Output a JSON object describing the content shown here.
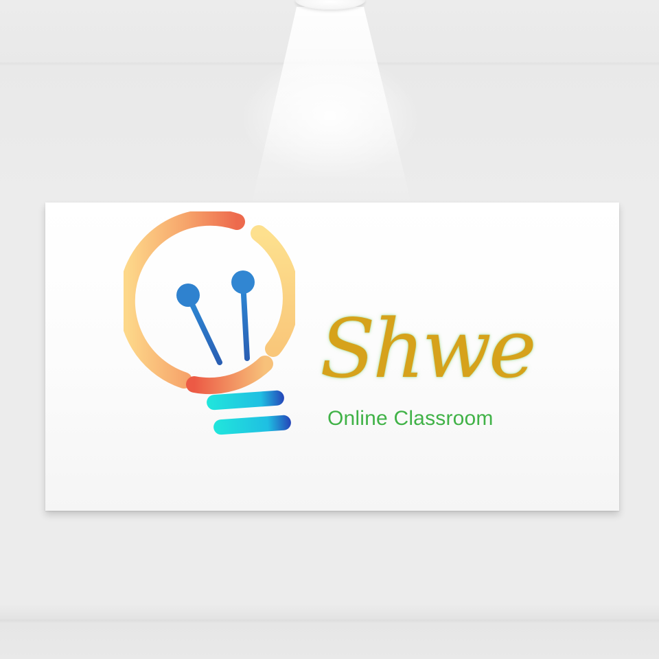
{
  "logo": {
    "brand_name": "Shwe",
    "tagline": "Online Classroom",
    "icon": "lightbulb-icon",
    "colors": {
      "brand_name": "#d6a21b",
      "brand_glow": "#96d778",
      "tagline": "#40b247",
      "bulb_ring_light": "#fcd98a",
      "bulb_ring_accent": "#ec6048",
      "filament": "#2f7ec9",
      "base_stripes": "#1fe2de"
    }
  }
}
